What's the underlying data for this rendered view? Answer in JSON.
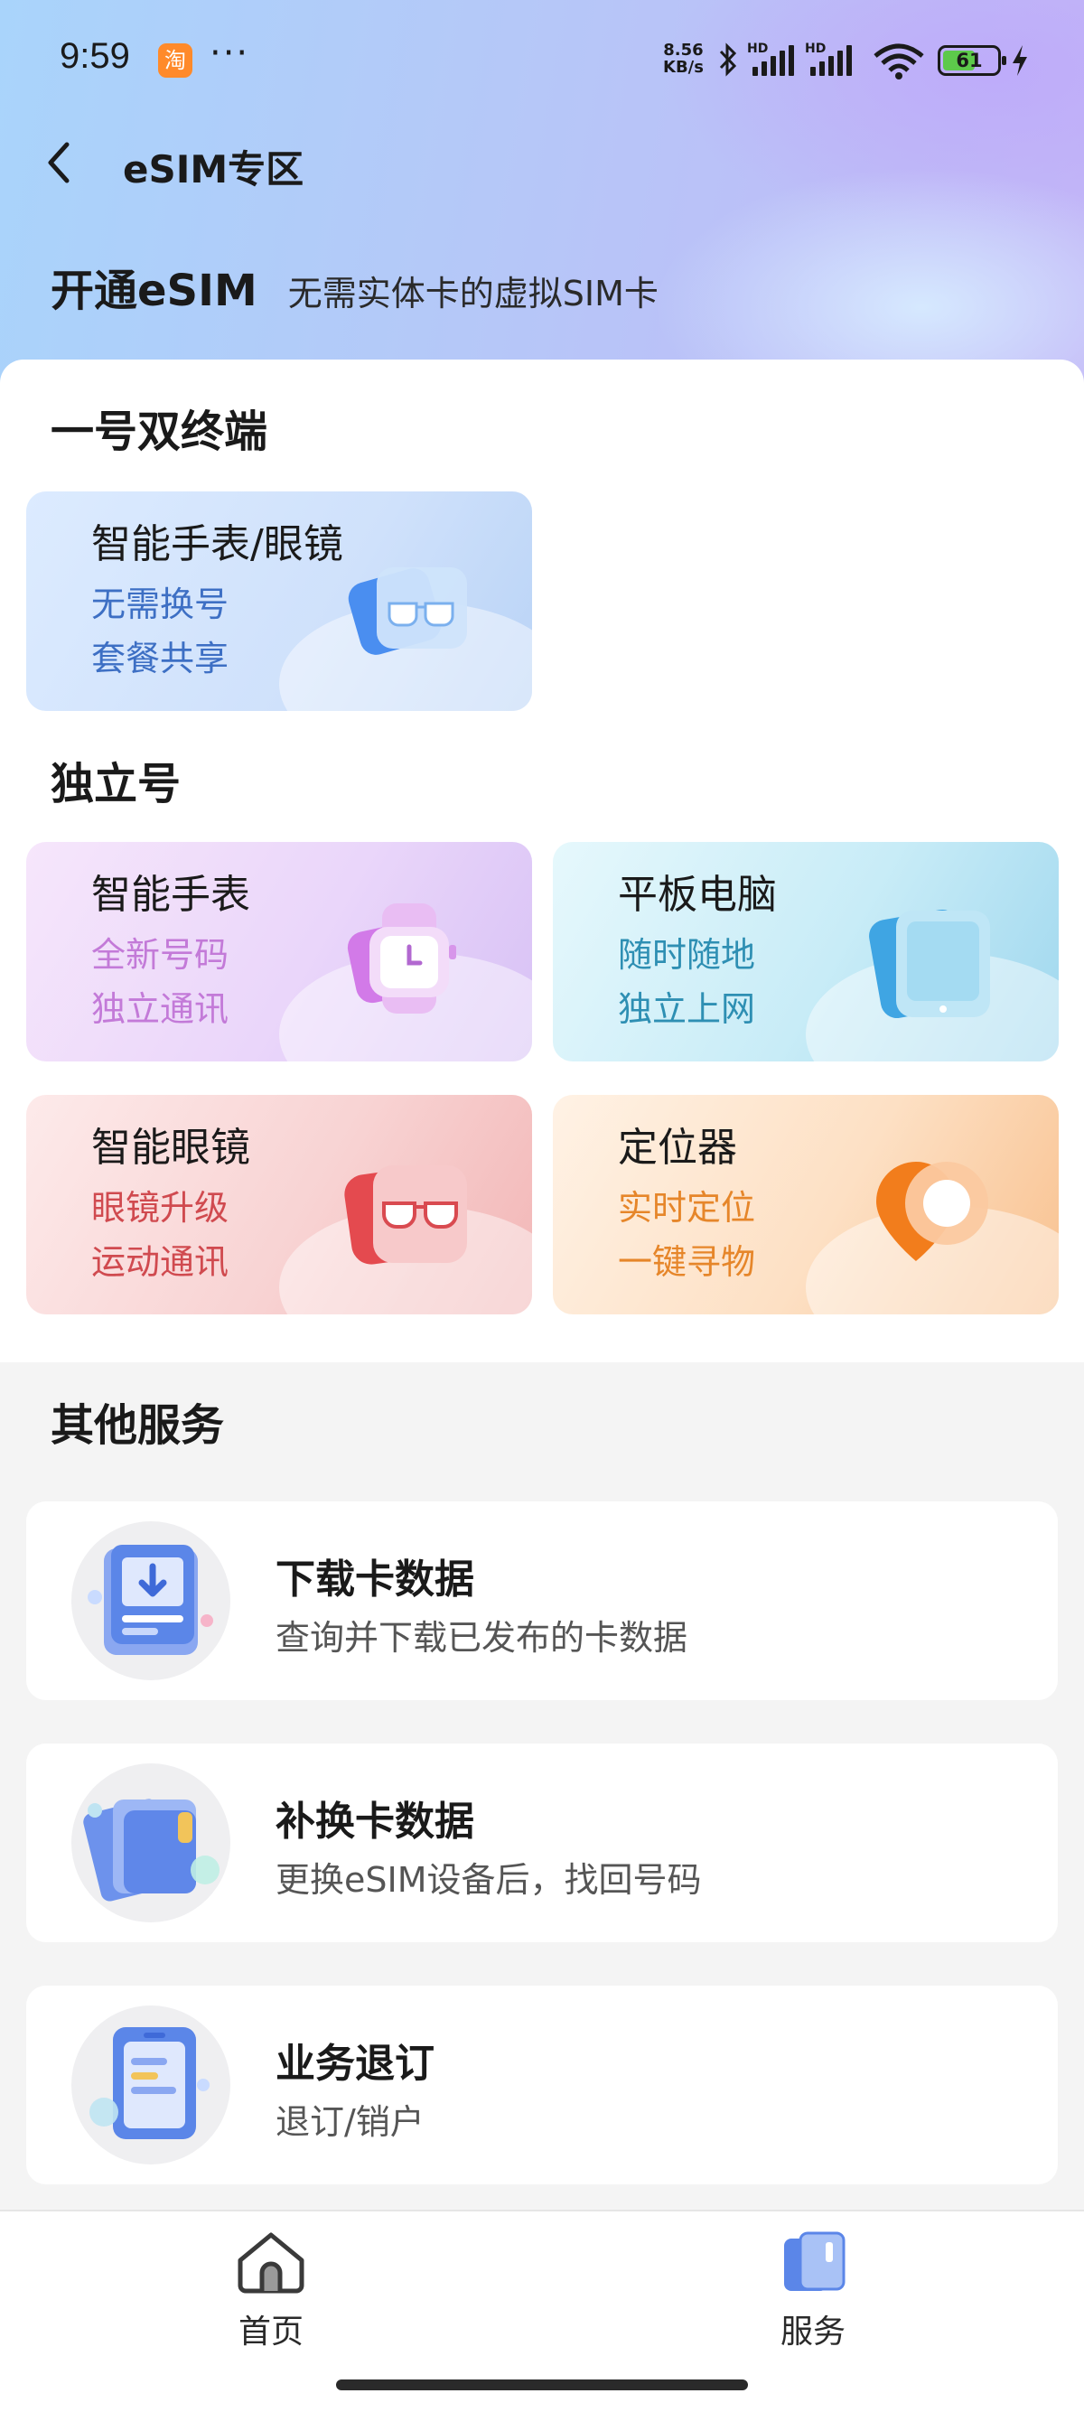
{
  "status_bar": {
    "time": "9:59",
    "app_badge": "淘",
    "more": "···",
    "net_speed_value": "8.56",
    "net_speed_unit": "KB/s",
    "hd_1": "HD",
    "hd_2": "HD",
    "battery": "61"
  },
  "nav": {
    "title": "eSIM专区"
  },
  "promo": {
    "title": "开通eSIM",
    "subtitle": "无需实体卡的虚拟SIM卡"
  },
  "sections": {
    "dual": {
      "title": "一号双终端"
    },
    "independent": {
      "title": "独立号"
    },
    "other": {
      "title": "其他服务"
    }
  },
  "cards": {
    "dual": {
      "name": "智能手表/眼镜",
      "line1": "无需换号",
      "line2": "套餐共享"
    },
    "watch": {
      "name": "智能手表",
      "line1": "全新号码",
      "line2": "独立通讯"
    },
    "tablet": {
      "name": "平板电脑",
      "line1": "随时随地",
      "line2": "独立上网"
    },
    "glasses": {
      "name": "智能眼镜",
      "line1": "眼镜升级",
      "line2": "运动通讯"
    },
    "locator": {
      "name": "定位器",
      "line1": "实时定位",
      "line2": "一键寻物"
    }
  },
  "services": [
    {
      "title": "下载卡数据",
      "desc": "查询并下载已发布的卡数据",
      "icon": "download-card-icon"
    },
    {
      "title": "补换卡数据",
      "desc": "更换eSIM设备后，找回号码",
      "icon": "replace-card-icon"
    },
    {
      "title": "业务退订",
      "desc": "退订/销户",
      "icon": "unsubscribe-icon"
    }
  ],
  "tabbar": {
    "home": "首页",
    "service": "服务"
  }
}
